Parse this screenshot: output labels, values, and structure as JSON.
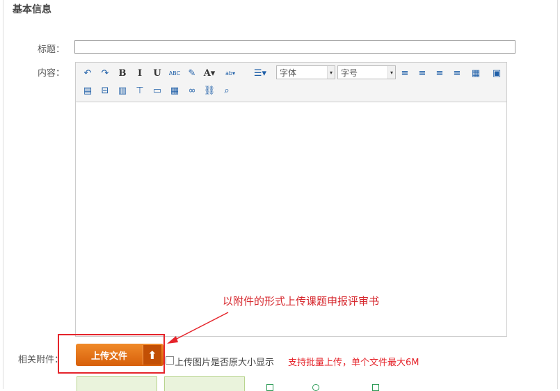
{
  "section": {
    "title": "基本信息"
  },
  "form": {
    "title_label": "标题：",
    "title_value": "",
    "content_label": "内容：",
    "attachment_label": "相关附件："
  },
  "toolbar": {
    "row1": [
      {
        "name": "undo-icon",
        "glyph": "↶"
      },
      {
        "name": "redo-icon",
        "glyph": "↷"
      },
      {
        "name": "bold-icon",
        "glyph": "B"
      },
      {
        "name": "italic-icon",
        "glyph": "I"
      },
      {
        "name": "underline-icon",
        "glyph": "U"
      },
      {
        "name": "strikethrough-icon",
        "glyph": "ABC"
      },
      {
        "name": "eraser-icon",
        "glyph": "✎"
      },
      {
        "name": "font-color-icon",
        "glyph": "A▾"
      },
      {
        "name": "highlight-icon",
        "glyph": "ab▾"
      },
      {
        "name": "line-spacing-icon",
        "glyph": "☰▾"
      }
    ],
    "font_family": "字体",
    "font_size": "字号",
    "row1_right": [
      {
        "name": "align-left-icon",
        "glyph": "≡"
      },
      {
        "name": "align-center-icon",
        "glyph": "≡"
      },
      {
        "name": "align-right-icon",
        "glyph": "≡"
      },
      {
        "name": "justify-icon",
        "glyph": "≡"
      },
      {
        "name": "table-icon",
        "glyph": "▦"
      },
      {
        "name": "preview-icon",
        "glyph": "▣"
      }
    ],
    "row2": [
      {
        "name": "insert-row-icon",
        "glyph": "▤"
      },
      {
        "name": "delete-row-icon",
        "glyph": "⊟"
      },
      {
        "name": "insert-col-icon",
        "glyph": "▥"
      },
      {
        "name": "delete-col-icon",
        "glyph": "⊤"
      },
      {
        "name": "merge-cells-icon",
        "glyph": "▭"
      },
      {
        "name": "split-cells-icon",
        "glyph": "▦"
      },
      {
        "name": "link-icon",
        "glyph": "∞"
      },
      {
        "name": "unlink-icon",
        "glyph": "⛓"
      },
      {
        "name": "search-icon",
        "glyph": "⌕"
      }
    ]
  },
  "annotation": "以附件的形式上传课题申报评审书",
  "upload": {
    "label": "上传文件",
    "icon": "upload-arrow-icon"
  },
  "checkbox_label": "上传图片是否原大小显示",
  "hint": "支持批量上传，单个文件最大6M",
  "colors": {
    "accent_red": "#e5242b",
    "upload_orange": "#e0701a"
  }
}
